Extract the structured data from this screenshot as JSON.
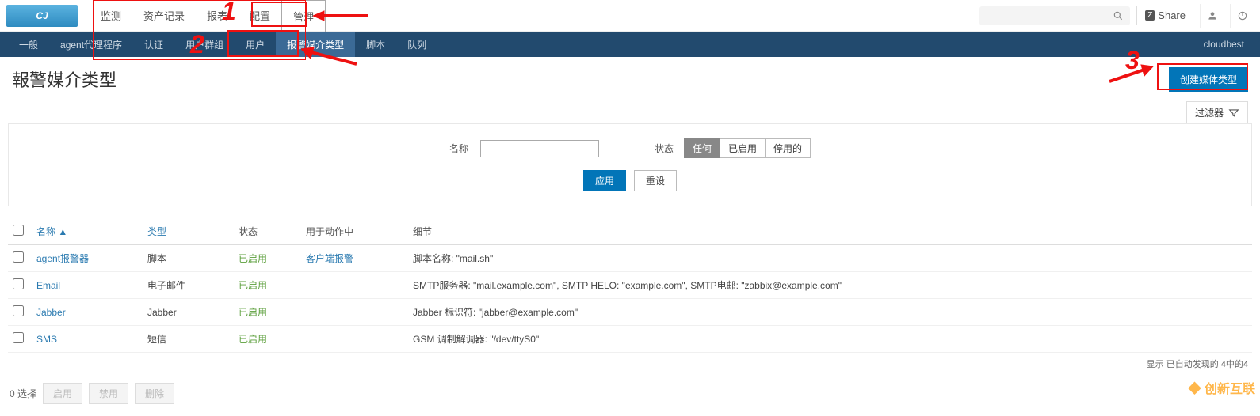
{
  "top_nav": {
    "items": [
      "监测",
      "资产记录",
      "报表",
      "配置",
      "管理"
    ],
    "active_index": 4,
    "share_label": "Share"
  },
  "sub_nav": {
    "items": [
      "一般",
      "agent代理程序",
      "认证",
      "用户群组",
      "用户",
      "报警媒介类型",
      "脚本",
      "队列"
    ],
    "active_index": 5,
    "right_text": "cloudbest"
  },
  "page": {
    "title": "報警媒介类型",
    "create_btn": "创建媒体类型",
    "filter_tab": "过滤器"
  },
  "filter": {
    "name_label": "名称",
    "name_value": "",
    "status_label": "状态",
    "status_opts": [
      "任何",
      "已启用",
      "停用的"
    ],
    "status_active": 0,
    "apply": "应用",
    "reset": "重设"
  },
  "table": {
    "headers": {
      "name": "名称 ▲",
      "type": "类型",
      "status": "状态",
      "action": "用于动作中",
      "detail": "细节"
    },
    "rows": [
      {
        "name": "agent报警器",
        "type": "脚本",
        "status": "已启用",
        "action": "客户端报警",
        "detail": "脚本名称: \"mail.sh\""
      },
      {
        "name": "Email",
        "type": "电子邮件",
        "status": "已启用",
        "action": "",
        "detail": "SMTP服务器: \"mail.example.com\", SMTP HELO: \"example.com\", SMTP电邮: \"zabbix@example.com\""
      },
      {
        "name": "Jabber",
        "type": "Jabber",
        "status": "已启用",
        "action": "",
        "detail": "Jabber 标识符: \"jabber@example.com\""
      },
      {
        "name": "SMS",
        "type": "短信",
        "status": "已启用",
        "action": "",
        "detail": "GSM 调制解调器: \"/dev/ttyS0\""
      }
    ]
  },
  "pager": "显示 已自动发现的 4中的4",
  "footer": {
    "selected": "0 选择",
    "enable": "启用",
    "disable": "禁用",
    "delete": "删除"
  },
  "watermark": "创新互联"
}
